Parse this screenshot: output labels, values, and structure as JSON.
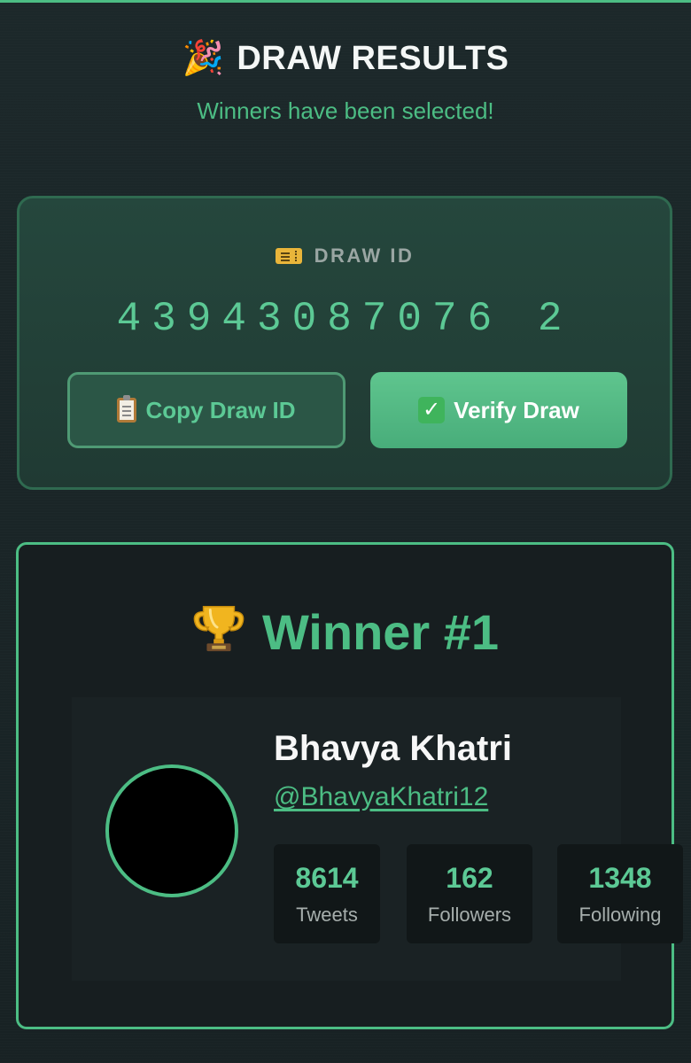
{
  "header": {
    "title": "DRAW RESULTS",
    "title_icon": "party-popper-icon",
    "subtitle": "Winners have been selected!"
  },
  "draw": {
    "label": "DRAW ID",
    "label_icon": "ticket-icon",
    "id": "43943087076 2",
    "copy_label": "Copy Draw ID",
    "copy_icon": "clipboard-icon",
    "verify_label": "Verify Draw",
    "verify_icon": "check-mark-icon"
  },
  "winner": {
    "title": "Winner #1",
    "title_icon": "trophy-icon",
    "name": "Bhavya Khatri",
    "handle": "@BhavyaKhatri12",
    "stats": [
      {
        "value": "8614",
        "label": "Tweets"
      },
      {
        "value": "162",
        "label": "Followers"
      },
      {
        "value": "1348",
        "label": "Following"
      }
    ]
  },
  "colors": {
    "accent": "#4cbd84",
    "background": "#1a2527",
    "card": "#203a33"
  }
}
